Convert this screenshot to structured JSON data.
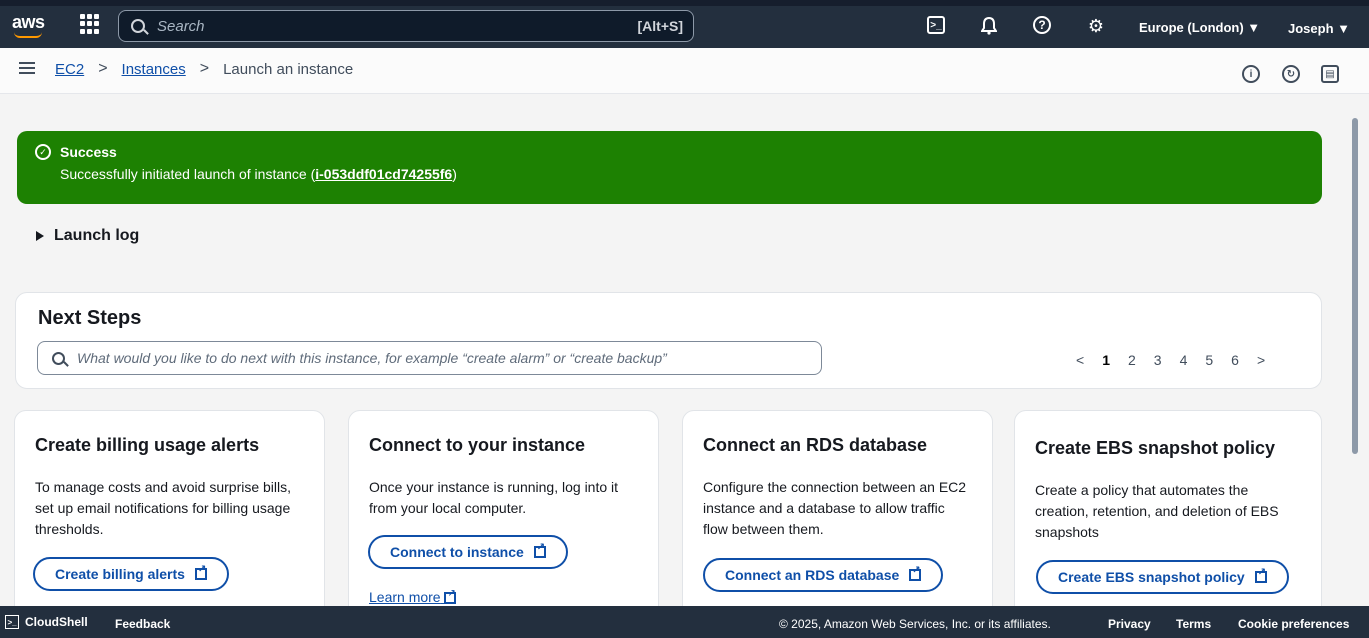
{
  "topbar": {
    "logo": "aws",
    "search_placeholder": "Search",
    "search_shortcut": "[Alt+S]",
    "icons": [
      "cloudshell-icon",
      "bell-icon",
      "help-icon",
      "gear-icon"
    ],
    "region": "Europe (London) ▼",
    "user": "Joseph ▼"
  },
  "breadcrumb": {
    "items": [
      "EC2",
      "Instances"
    ],
    "current": "Launch an instance"
  },
  "flash": {
    "type": "success",
    "title": "Success",
    "message_prefix": "Successfully initiated launch of instance (",
    "instance_id": "i-053ddf01cd74255f6",
    "message_suffix": ")"
  },
  "launch_log": "Launch log",
  "next_steps": {
    "title": "Next Steps",
    "search_placeholder": "What would you like to do next with this instance, for example “create alarm” or “create backup”",
    "pages": [
      "1",
      "2",
      "3",
      "4",
      "5",
      "6"
    ],
    "current_page": "1"
  },
  "cards": [
    {
      "title": "Create billing usage alerts",
      "text": "To manage costs and avoid surprise bills, set up email notifications for billing usage thresholds.",
      "button": "Create billing alerts"
    },
    {
      "title": "Connect to your instance",
      "text": "Once your instance is running, log into it from your local computer.",
      "button": "Connect to instance",
      "link": "Learn more"
    },
    {
      "title": "Connect an RDS database",
      "text": "Configure the connection between an EC2 instance and a database to allow traffic flow between them.",
      "button": "Connect an RDS database"
    },
    {
      "title": "Create EBS snapshot policy",
      "text": "Create a policy that automates the creation, retention, and deletion of EBS snapshots",
      "button": "Create EBS snapshot policy"
    }
  ],
  "footer": {
    "cloudshell": "CloudShell",
    "feedback": "Feedback",
    "copyright": "© 2025, Amazon Web Services, Inc. or its affiliates.",
    "privacy": "Privacy",
    "terms": "Terms",
    "cookies": "Cookie preferences"
  },
  "colors": {
    "success": "#1d8102",
    "nav": "#232f3e",
    "link": "#0f4fa8",
    "brand": "#ff9900"
  }
}
